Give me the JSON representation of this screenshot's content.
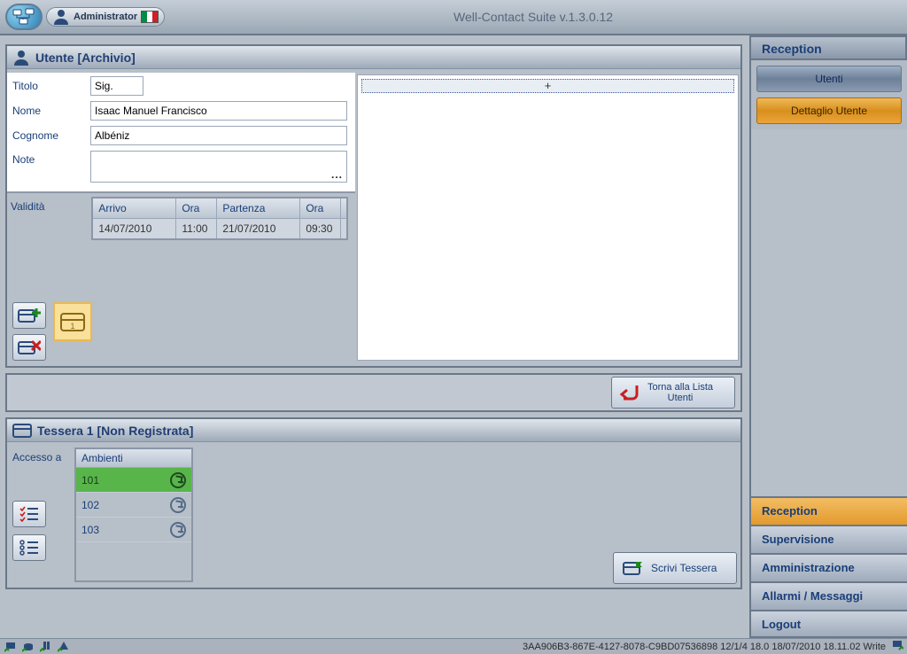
{
  "app": {
    "title": "Well-Contact Suite v.1.3.0.12",
    "admin_label": "Administrator"
  },
  "section_header": "Utente [Archivio]",
  "form": {
    "titolo_label": "Titolo",
    "titolo_value": "Sig.",
    "nome_label": "Nome",
    "nome_value": "Isaac Manuel Francisco",
    "cognome_label": "Cognome",
    "cognome_value": "Albéniz",
    "note_label": "Note",
    "note_value": ""
  },
  "validita": {
    "label": "Validità",
    "headers": {
      "arrivo": "Arrivo",
      "ora1": "Ora",
      "partenza": "Partenza",
      "ora2": "Ora"
    },
    "row": {
      "arrivo": "14/07/2010",
      "ora1": "11:00",
      "partenza": "21/07/2010",
      "ora2": "09:30"
    }
  },
  "plus_button": "+",
  "back_button": {
    "line1": "Torna alla Lista",
    "line2": "Utenti"
  },
  "tessera": {
    "header": "Tessera 1 [Non Registrata]",
    "accesso_label": "Accesso a",
    "ambienti_label": "Ambienti",
    "rooms": [
      "101",
      "102",
      "103"
    ],
    "write_label": "Scrivi Tessera"
  },
  "sidebar": {
    "top_header": "Reception",
    "btn_utenti": "Utenti",
    "btn_dettaglio": "Dettaglio Utente",
    "nav": [
      "Reception",
      "Supervisione",
      "Amministrazione",
      "Allarmi / Messaggi",
      "Logout"
    ]
  },
  "statusbar": "3AA906B3-867E-4127-8078-C9BD07536898 12/1/4 18.0 18/07/2010 18.11.02 Write"
}
